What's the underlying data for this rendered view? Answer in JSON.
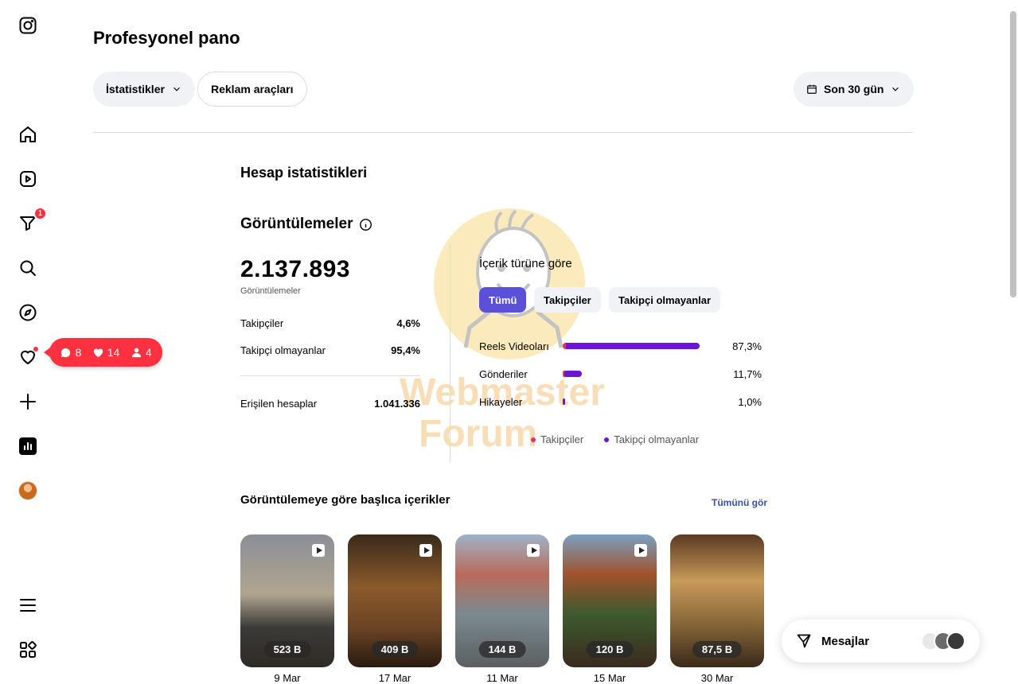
{
  "header": {
    "title": "Profesyonel pano",
    "insights_label": "İstatistikler",
    "ads_label": "Reklam araçları",
    "date_range_label": "Son 30 gün"
  },
  "sidebar": {
    "notification_badge": "1",
    "icons": [
      "instagram-icon",
      "home-icon",
      "reels-icon",
      "filter-icon",
      "search-icon",
      "explore-icon",
      "heart-icon",
      "create-icon",
      "dashboard-icon",
      "profile-icon",
      "menu-icon",
      "apps-icon"
    ]
  },
  "notification_pill": {
    "comments": "8",
    "likes": "14",
    "followers": "4"
  },
  "account_stats": {
    "section_title": "Hesap istatistikleri",
    "views_title": "Görüntülemeler",
    "views_total": "2.137.893",
    "views_label": "Görüntülemeler",
    "followers_label": "Takipçiler",
    "followers_value": "4,6%",
    "non_followers_label": "Takipçi olmayanlar",
    "non_followers_value": "95,4%",
    "reached_label": "Erişilen hesaplar",
    "reached_value": "1.041.336"
  },
  "by_type": {
    "title": "İçerik türüne göre",
    "tabs": [
      "Tümü",
      "Takipçiler",
      "Takipçi olmayanlar"
    ],
    "rows": [
      {
        "label": "Reels Videoları",
        "value": "87,3%"
      },
      {
        "label": "Gönderiler",
        "value": "11,7%"
      },
      {
        "label": "Hikayeler",
        "value": "1,0%"
      }
    ],
    "legend": [
      "Takipçiler",
      "Takipçi olmayanlar"
    ],
    "colors": {
      "followers": "#e1306c",
      "non_followers": "#6d14d6"
    }
  },
  "top_content": {
    "title": "Görüntülemeye göre başlıca içerikler",
    "see_all": "Tümünü gör",
    "items": [
      {
        "count": "523 B",
        "date": "9 Mar"
      },
      {
        "count": "409 B",
        "date": "17 Mar"
      },
      {
        "count": "144 B",
        "date": "11 Mar"
      },
      {
        "count": "120 B",
        "date": "15 Mar"
      },
      {
        "count": "87,5 B",
        "date": "30 Mar"
      }
    ]
  },
  "messages": {
    "label": "Mesajlar"
  },
  "watermark": {
    "line1": "Webmaster",
    "line2": "Forum"
  }
}
